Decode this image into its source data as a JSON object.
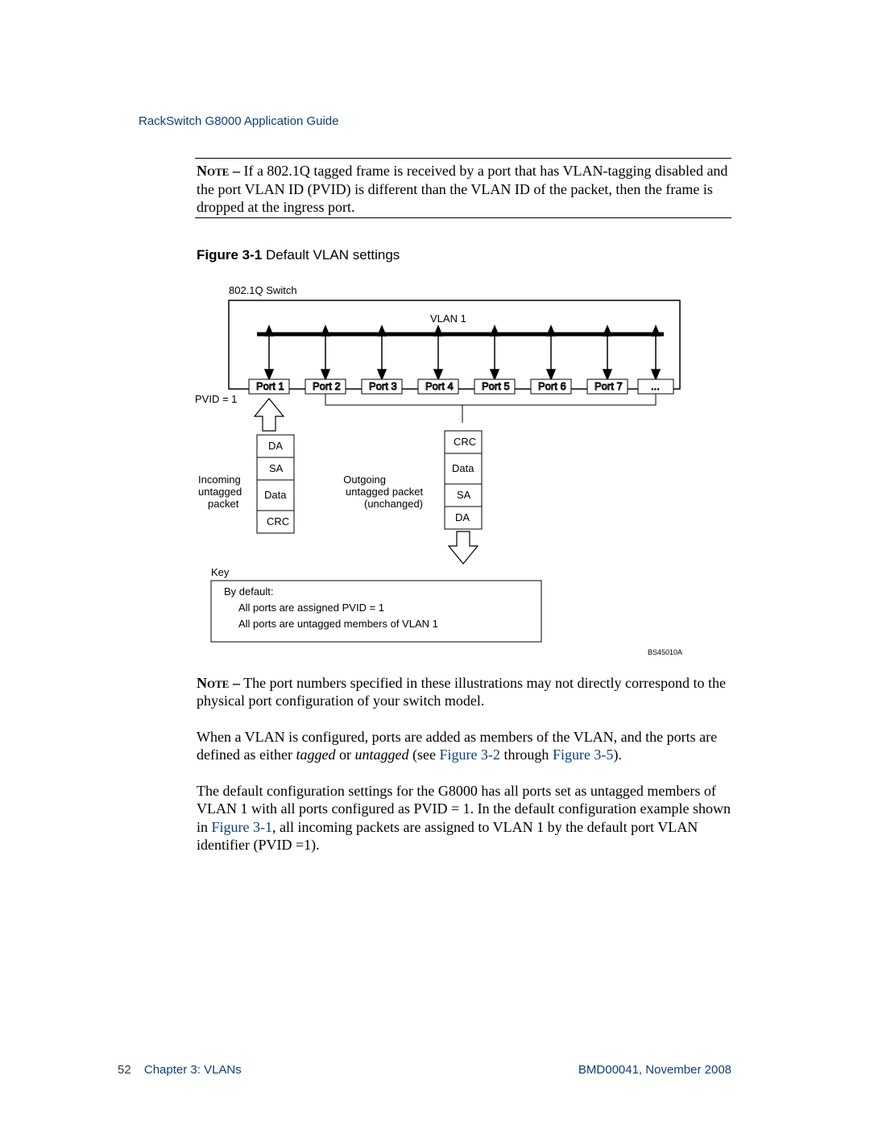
{
  "header": {
    "title": "RackSwitch G8000  Application Guide"
  },
  "note1": {
    "label": "Note –",
    "text": " If a 802.1Q tagged frame is received by a port that has VLAN-tagging disabled and the port VLAN ID (PVID) is different than the VLAN ID of the packet, then the frame is dropped at the ingress port."
  },
  "figure": {
    "caption_label": "Figure 3-1",
    "caption_text": "  Default VLAN settings",
    "switch_label": "802.1Q Switch",
    "vlan_label": "VLAN 1",
    "ports": [
      "Port 1",
      "Port 2",
      "Port 3",
      "Port 4",
      "Port 5",
      "Port 6",
      "Port 7",
      "..."
    ],
    "pvid_label": "PVID = 1",
    "incoming_label1": "Incoming",
    "incoming_label2": "untagged",
    "incoming_label3": "packet",
    "outgoing_label1": "Outgoing",
    "outgoing_label2": "untagged packet",
    "outgoing_label3": "(unchanged)",
    "stack_in": [
      "DA",
      "SA",
      "Data",
      "CRC"
    ],
    "stack_out": [
      "CRC",
      "Data",
      "SA",
      "DA"
    ],
    "key_title": "Key",
    "key_line1": "By default:",
    "key_line2": "All ports are assigned PVID = 1",
    "key_line3": "All ports are untagged members of VLAN 1",
    "diagram_id": "BS45010A"
  },
  "note2": {
    "label": "Note –",
    "text": " The port numbers specified in these illustrations may not directly correspond to the physical port configuration of your switch model."
  },
  "body": {
    "p1a": "When a VLAN is configured, ports are added as members of the VLAN, and the ports are defined as either ",
    "p1_i1": "tagged",
    "p1b": " or ",
    "p1_i2": "untagged",
    "p1c": " (see ",
    "p1_link1": "Figure 3-2",
    "p1d": " through ",
    "p1_link2": "Figure 3-5",
    "p1e": ").",
    "p2a": "The default configuration settings for the G8000 has all ports set as untagged members of VLAN 1 with all ports configured as PVID = 1. In the default configuration example shown in ",
    "p2_link": "Figure 3-1",
    "p2b": ", all incoming packets are assigned to VLAN 1 by the default port VLAN identifier (PVID =1)."
  },
  "footer": {
    "page": "52",
    "chapter": "Chapter 3:  VLANs",
    "docid": "BMD00041, November 2008"
  }
}
